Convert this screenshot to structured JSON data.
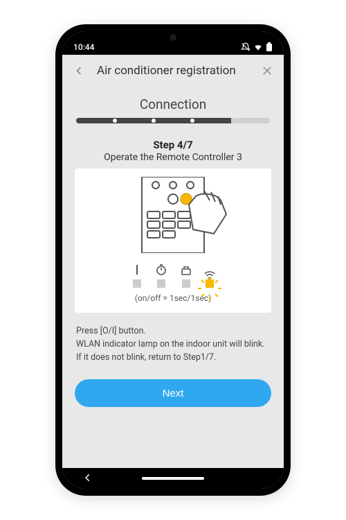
{
  "status": {
    "time": "10:44"
  },
  "appbar": {
    "title": "Air conditioner registration"
  },
  "section": {
    "title": "Connection"
  },
  "progress": {
    "current": 4,
    "total": 7
  },
  "step": {
    "label": "Step 4/7",
    "subtitle": "Operate the Remote Controller 3",
    "blink_text": "(on/off = 1sec/1sec)"
  },
  "indicators": [
    "power-icon",
    "timer-icon",
    "device-icon",
    "wifi-icon"
  ],
  "instructions": {
    "line1": "Press [O/I] button.",
    "line2": "WLAN indicator lamp on the indoor unit will blink.",
    "line3": "If it does not blink, return to Step1/7."
  },
  "buttons": {
    "next": "Next"
  }
}
